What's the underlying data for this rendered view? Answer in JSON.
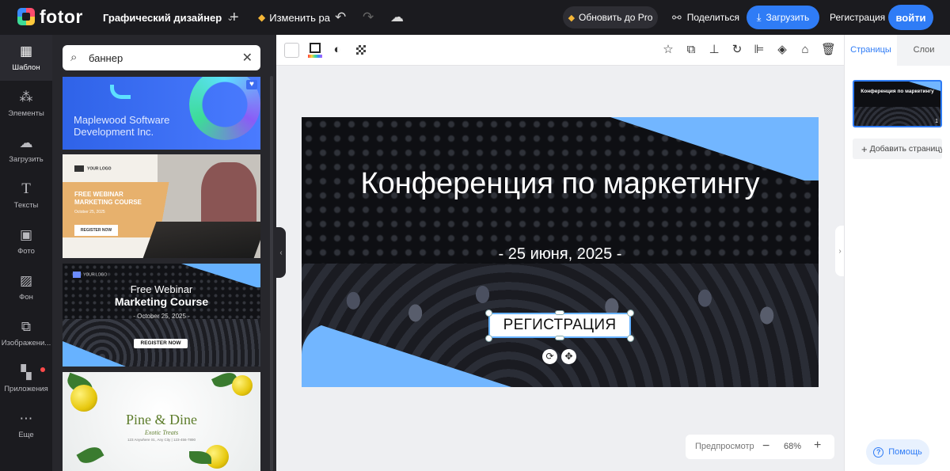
{
  "app": {
    "logo": "fotor"
  },
  "topbar": {
    "mode": "Графический дизайнер",
    "rename": "Изменить ра",
    "upgrade": "Обновить до Pro",
    "share": "Поделиться",
    "upload": "Загрузить",
    "register": "Регистрация",
    "login": "войти"
  },
  "sidebar": {
    "items": [
      {
        "label": "Шаблон",
        "icon": "template-icon"
      },
      {
        "label": "Элементы",
        "icon": "elements-icon"
      },
      {
        "label": "Загрузить",
        "icon": "upload-cloud-icon"
      },
      {
        "label": "Тексты",
        "icon": "text-icon"
      },
      {
        "label": "Фото",
        "icon": "photo-icon"
      },
      {
        "label": "Фон",
        "icon": "background-icon"
      },
      {
        "label": "Изображени...",
        "icon": "images-icon"
      },
      {
        "label": "Приложения",
        "icon": "apps-icon"
      },
      {
        "label": "Еще",
        "icon": "more-icon"
      }
    ]
  },
  "search": {
    "value": "баннер"
  },
  "templates": [
    {
      "lines": [
        "Maplewood Software",
        "Development Inc."
      ]
    },
    {
      "logo": "YOUR LOGO",
      "lines": [
        "FREE WEBINAR",
        "MARKETING COURSE"
      ],
      "date": "October 25, 2025",
      "button": "REGISTER NOW"
    },
    {
      "logo": "YOUR LOGO",
      "line1": "Free Webinar",
      "line2": "Marketing Course",
      "date": "- October 25, 2025 -",
      "button": "REGISTER NOW"
    },
    {
      "line1": "Pine & Dine",
      "line2": "Exotic Treats",
      "line3": "123 Anywhere St., Any City | 123-456-7890"
    }
  ],
  "canvas": {
    "title": "Конференция по маркетингу",
    "date": "- 25 июня, 2025 -",
    "button": "РЕГИСТРАЦИЯ"
  },
  "zoom": {
    "preview": "Предпросмотр",
    "level": "68%"
  },
  "rightpanel": {
    "tabs": [
      "Страницы",
      "Слои"
    ],
    "thumb_title": "Конференция по маркетингу",
    "page_number": "1",
    "add_page": "Добавить страницу",
    "help": "Помощь"
  },
  "colors": {
    "accent": "#2f7cf6",
    "canvas_blue": "#72b6ff",
    "topbar": "#1b1b1f"
  }
}
